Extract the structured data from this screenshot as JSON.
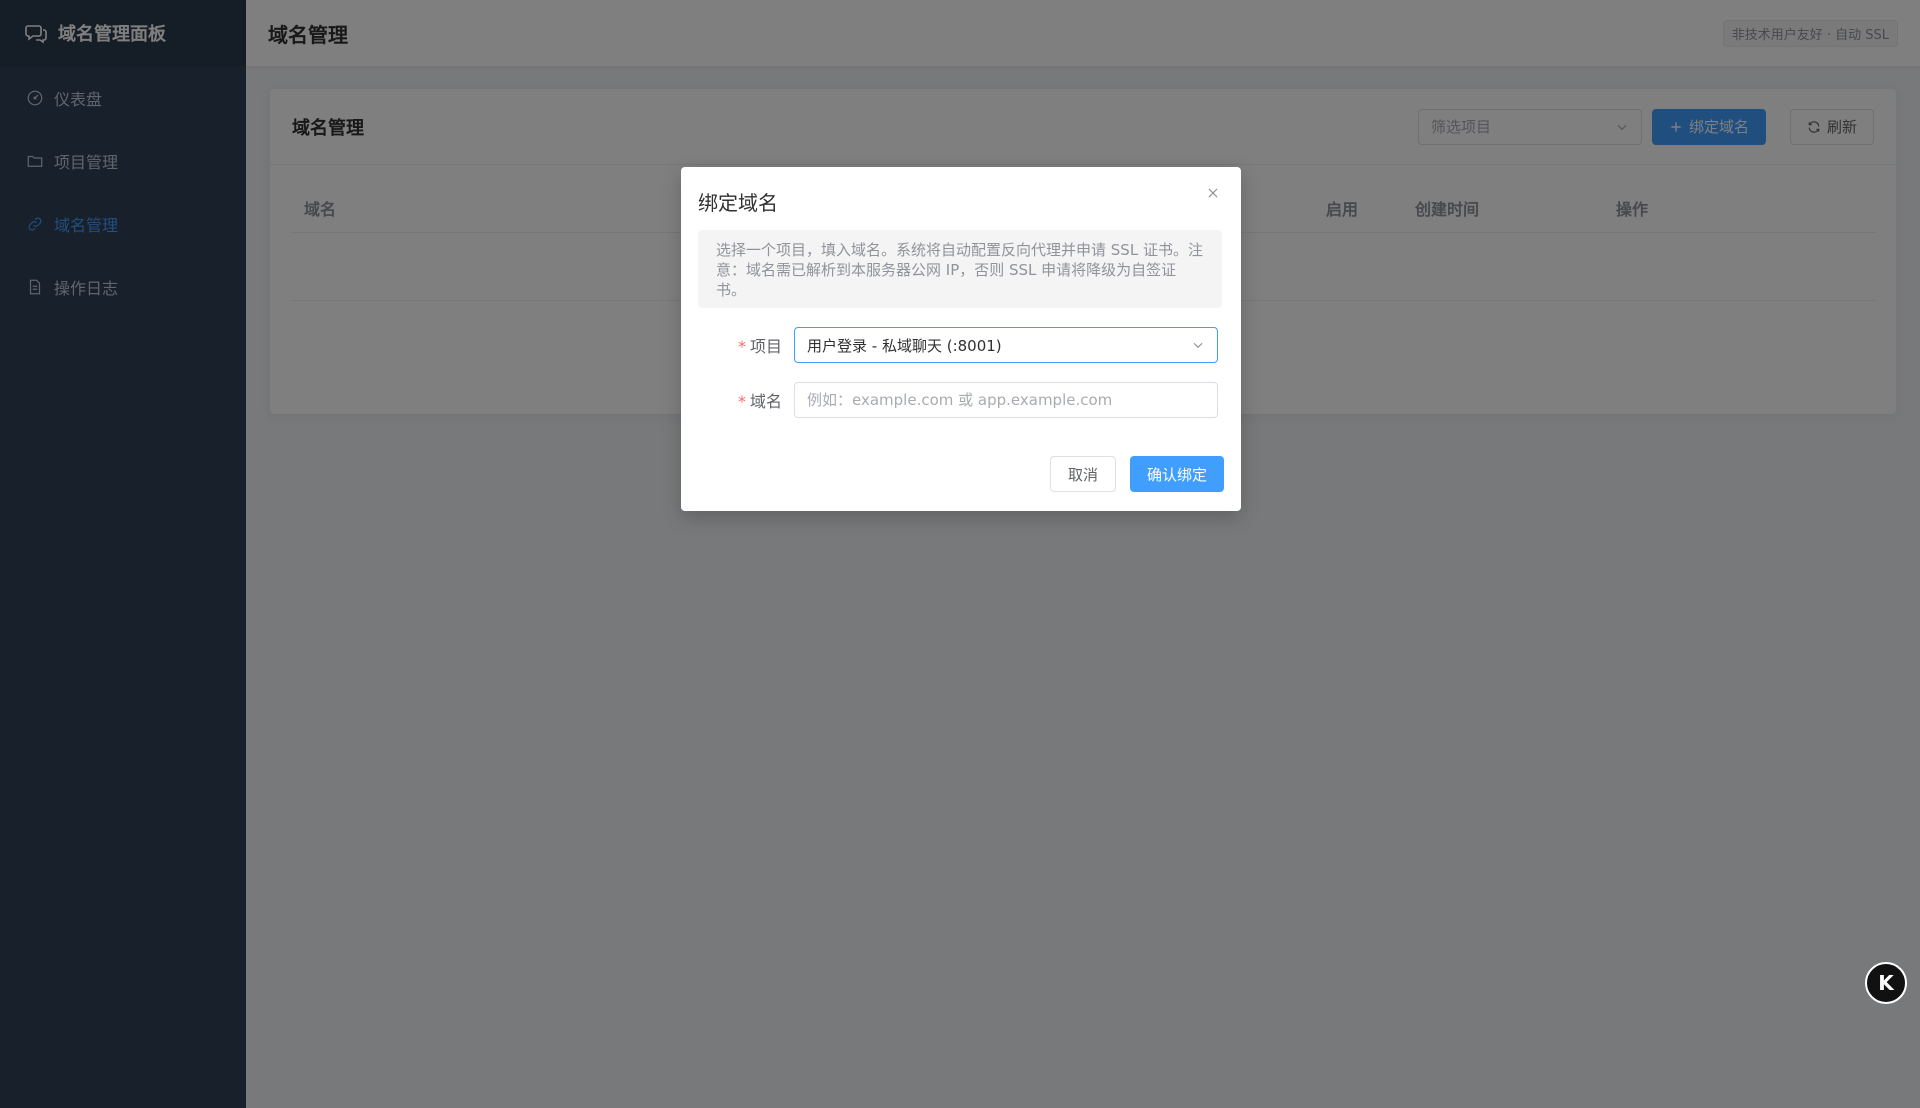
{
  "sidebar": {
    "brand": "域名管理面板",
    "items": [
      {
        "label": "仪表盘",
        "icon": "dashboard-icon",
        "active": false
      },
      {
        "label": "项目管理",
        "icon": "folder-icon",
        "active": false
      },
      {
        "label": "域名管理",
        "icon": "link-icon",
        "active": true
      },
      {
        "label": "操作日志",
        "icon": "document-icon",
        "active": false
      }
    ]
  },
  "header": {
    "title": "域名管理",
    "tag": "非技术用户友好 · 自动 SSL"
  },
  "card": {
    "title": "域名管理",
    "filter_placeholder": "筛选项目",
    "bind_button": "绑定域名",
    "refresh_button": "刷新",
    "columns": [
      "域名",
      "启用",
      "创建时间",
      "操作"
    ]
  },
  "dialog": {
    "title": "绑定域名",
    "alert": "选择一个项目，填入域名。系统将自动配置反向代理并申请 SSL 证书。注意：域名需已解析到本服务器公网 IP，否则 SSL 申请将降级为自签证书。",
    "project_label": "项目",
    "project_value": "用户登录 - 私域聊天 (:8001)",
    "domain_label": "域名",
    "domain_placeholder": "例如：example.com 或 app.example.com",
    "domain_value": "",
    "cancel": "取消",
    "confirm": "确认绑定"
  },
  "float_badge": "K",
  "colors": {
    "sidebar_bg": "#304156",
    "primary": "#409eff",
    "required": "#f56c6c"
  }
}
